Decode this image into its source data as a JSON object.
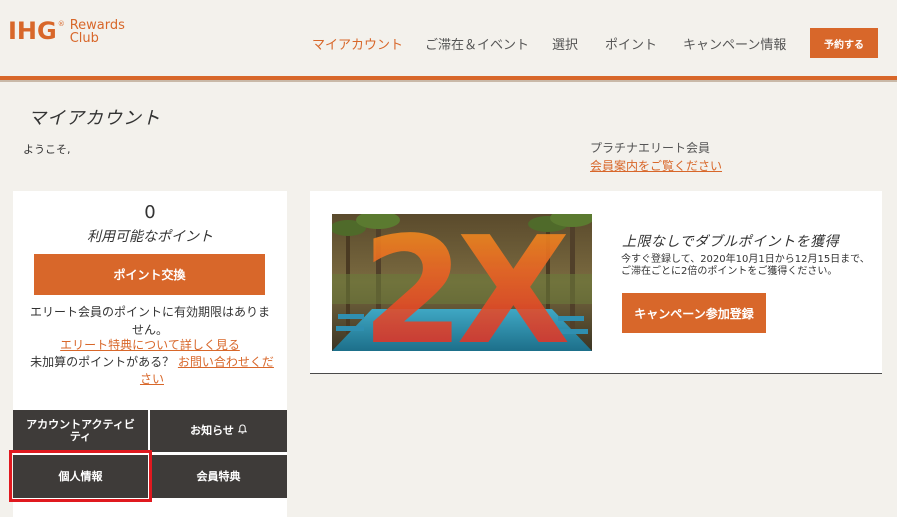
{
  "brand": {
    "logo_main": "IHG",
    "logo_reg": "®",
    "logo_sub_line1": "Rewards",
    "logo_sub_line2": "Club",
    "accent": "#d8672a"
  },
  "nav": {
    "items": [
      {
        "label": "マイアカウント",
        "active": true
      },
      {
        "label": "ご滞在＆イベント",
        "active": false
      },
      {
        "label": "選択",
        "active": false
      },
      {
        "label": "ポイント",
        "active": false
      },
      {
        "label": "キャンペーン情報",
        "active": false
      }
    ],
    "book_label": "予約する"
  },
  "page": {
    "title": "マイアカウント",
    "welcome": "ようこそ,",
    "tier": "プラチナエリート会員",
    "tier_link": "会員案内をご覧ください"
  },
  "points": {
    "value": "0",
    "label": "利用可能なポイント",
    "exchange_label": "ポイント交換",
    "elite_note": "エリート会員のポイントに有効期限はありません。",
    "elite_link": "エリート特典について詳しく見る",
    "missing_text": "未加算のポイントがある？",
    "missing_link": "お問い合わせください"
  },
  "tiles": {
    "activity": "アカウントアクティビティ",
    "notice": "お知らせ",
    "notice_icon": "bell-icon",
    "profile": "個人情報",
    "benefits": "会員特典"
  },
  "promo": {
    "image_text": "2X",
    "title": "上限なしでダブルポイントを獲得",
    "desc": "今すぐ登録して、2020年10月1日から12月15日まで、ご滞在ごとに2倍のポイントをご獲得ください。",
    "button": "キャンペーン参加登録"
  },
  "annotation": {
    "highlight_color": "#e0191f"
  }
}
